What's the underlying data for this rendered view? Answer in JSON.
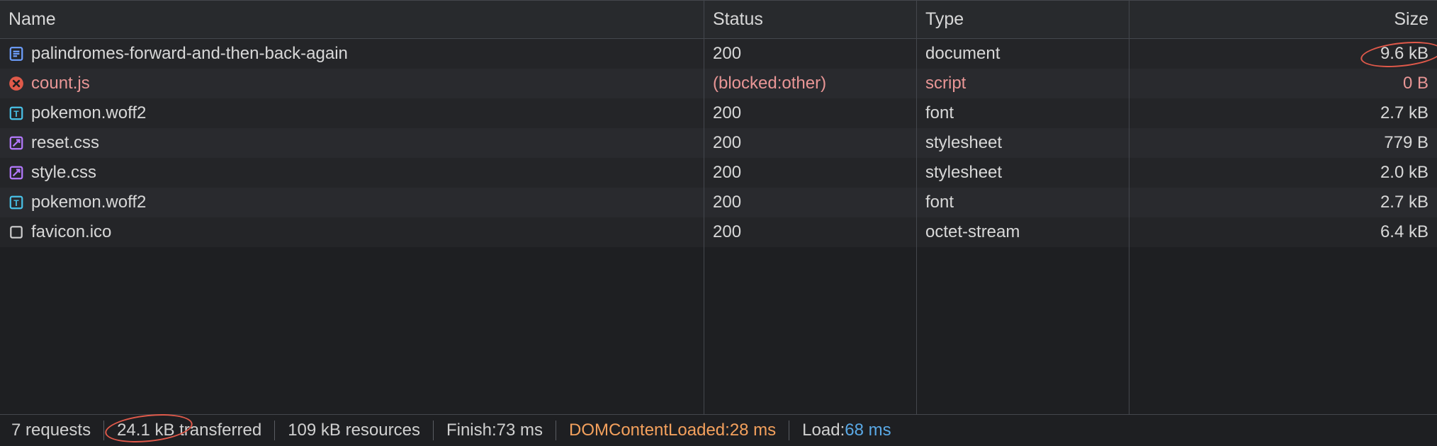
{
  "columns": {
    "name": "Name",
    "status": "Status",
    "type": "Type",
    "size": "Size"
  },
  "rows": [
    {
      "icon": "document",
      "name": "palindromes-forward-and-then-back-again",
      "status": "200",
      "type": "document",
      "size": "9.6 kB",
      "blocked": false
    },
    {
      "icon": "error",
      "name": "count.js",
      "status": "(blocked:other)",
      "type": "script",
      "size": "0 B",
      "blocked": true
    },
    {
      "icon": "font",
      "name": "pokemon.woff2",
      "status": "200",
      "type": "font",
      "size": "2.7 kB",
      "blocked": false
    },
    {
      "icon": "style",
      "name": "reset.css",
      "status": "200",
      "type": "stylesheet",
      "size": "779 B",
      "blocked": false
    },
    {
      "icon": "style",
      "name": "style.css",
      "status": "200",
      "type": "stylesheet",
      "size": "2.0 kB",
      "blocked": false
    },
    {
      "icon": "font",
      "name": "pokemon.woff2",
      "status": "200",
      "type": "font",
      "size": "2.7 kB",
      "blocked": false
    },
    {
      "icon": "other",
      "name": "favicon.ico",
      "status": "200",
      "type": "octet-stream",
      "size": "6.4 kB",
      "blocked": false
    }
  ],
  "status": {
    "requests": "7 requests",
    "transferred": "24.1 kB transferred",
    "resources": "109 kB resources",
    "finish_label": "Finish: ",
    "finish_value": "73 ms",
    "dcl_label": "DOMContentLoaded: ",
    "dcl_value": "28 ms",
    "load_label": "Load: ",
    "load_value": "68 ms"
  }
}
